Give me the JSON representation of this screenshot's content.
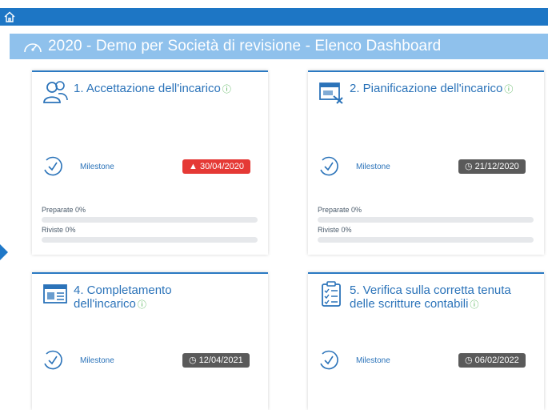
{
  "header": {
    "home_icon": "home-icon",
    "title": "2020 - Demo per Società di revisione - Elenco Dashboard",
    "title_icon": "gauge-icon"
  },
  "cards": [
    {
      "title": "1. Accettazione dell'incarico",
      "icon": "users-icon",
      "milestone_label": "Milestone",
      "milestone_date": "30/04/2020",
      "milestone_status": "warning",
      "progress": [
        {
          "label": "Preparate 0%",
          "value": 0
        },
        {
          "label": "Riviste 0%",
          "value": 0
        }
      ]
    },
    {
      "title": "2. Pianificazione dell'incarico",
      "icon": "planning-icon",
      "milestone_label": "Milestone",
      "milestone_date": "21/12/2020",
      "milestone_status": "scheduled",
      "progress": [
        {
          "label": "Preparate 0%",
          "value": 0
        },
        {
          "label": "Riviste 0%",
          "value": 0
        }
      ]
    },
    {
      "title": "4. Completamento dell'incarico",
      "icon": "document-icon",
      "milestone_label": "Milestone",
      "milestone_date": "12/04/2021",
      "milestone_status": "scheduled"
    },
    {
      "title": "5. Verifica sulla corretta tenuta delle scritture contabili",
      "icon": "checklist-icon",
      "milestone_label": "Milestone",
      "milestone_date": "06/02/2022",
      "milestone_status": "scheduled"
    }
  ],
  "colors": {
    "topbar": "#1d76c5",
    "titlebar": "#8fc1ec",
    "accent": "#2b73b9",
    "warning": "#e53935",
    "scheduled": "#5a5a5a"
  }
}
